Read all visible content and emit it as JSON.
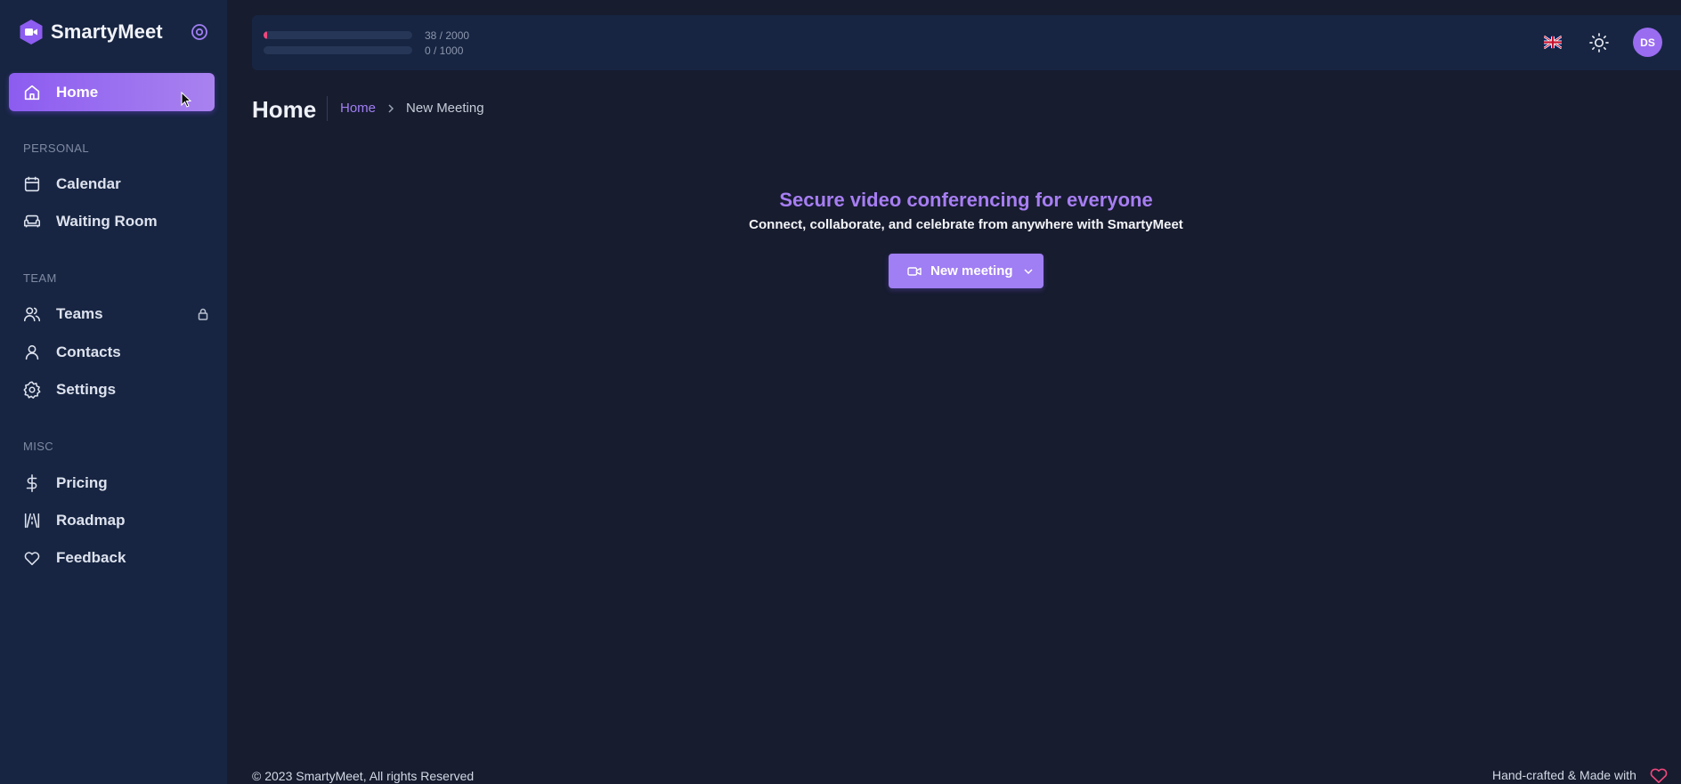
{
  "app": {
    "name": "SmartyMeet"
  },
  "sidebar": {
    "home": {
      "label": "Home",
      "icon": "home-icon"
    },
    "sections": [
      {
        "title": "PERSONAL",
        "items": [
          {
            "label": "Calendar",
            "icon": "calendar-icon"
          },
          {
            "label": "Waiting Room",
            "icon": "sofa-icon"
          }
        ]
      },
      {
        "title": "TEAM",
        "items": [
          {
            "label": "Teams",
            "icon": "users-icon",
            "locked": true
          },
          {
            "label": "Contacts",
            "icon": "user-icon"
          },
          {
            "label": "Settings",
            "icon": "gear-icon"
          }
        ]
      },
      {
        "title": "MISC",
        "items": [
          {
            "label": "Pricing",
            "icon": "dollar-icon"
          },
          {
            "label": "Roadmap",
            "icon": "road-icon"
          },
          {
            "label": "Feedback",
            "icon": "heart-icon"
          }
        ]
      }
    ]
  },
  "topbar": {
    "usage": [
      {
        "text": "38 / 2000",
        "fraction": 0.019
      },
      {
        "text": "0 / 1000",
        "fraction": 0.0
      }
    ],
    "language_flag": "uk-flag-icon",
    "theme_icon": "sun-icon",
    "avatar_initials": "DS"
  },
  "header": {
    "title": "Home",
    "breadcrumb": {
      "link": "Home",
      "current": "New Meeting"
    }
  },
  "hero": {
    "title": "Secure video conferencing for everyone",
    "subtitle": "Connect, collaborate, and celebrate from anywhere with SmartyMeet",
    "button_label": "New meeting"
  },
  "footer": {
    "copyright": "© 2023 SmartyMeet, All rights Reserved",
    "credit": "Hand-crafted & Made with"
  },
  "colors": {
    "accent": "#a07ef3",
    "sidebar_bg": "#172542",
    "page_bg": "#171c2f",
    "usage_fill": "#f0487c"
  }
}
